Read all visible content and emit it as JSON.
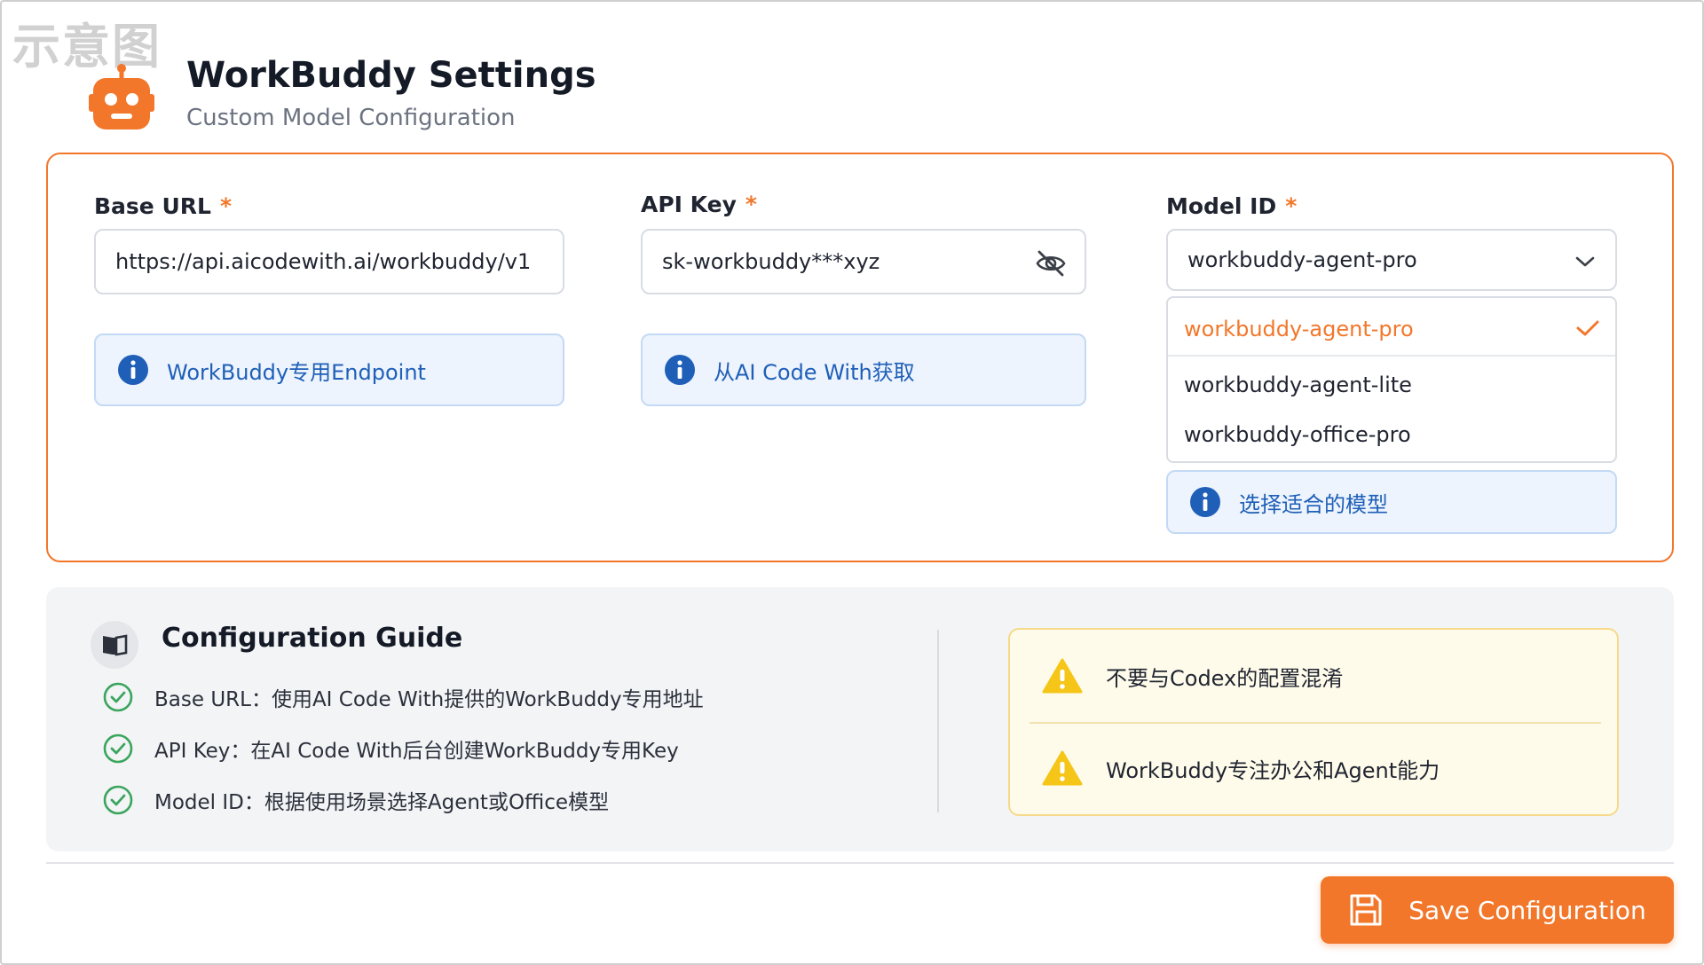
{
  "watermark": "示意图",
  "header": {
    "title": "WorkBuddy Settings",
    "subtitle": "Custom Model Configuration",
    "logo_icon": "robot-icon"
  },
  "colors": {
    "accent": "#f2772b",
    "info": "#1f5fb8",
    "success": "#3aa55d",
    "warning": "#f5c518"
  },
  "fields": {
    "base_url": {
      "label": "Base URL",
      "required_mark": "*",
      "value": "https://api.aicodewith.ai/workbuddy/v1",
      "hint": "WorkBuddy专用Endpoint"
    },
    "api_key": {
      "label": "API Key",
      "required_mark": "*",
      "value": "sk-workbuddy***xyz",
      "hint": "从AI Code With获取",
      "toggle_icon": "eye-off-icon"
    },
    "model_id": {
      "label": "Model ID",
      "required_mark": "*",
      "value": "workbuddy-agent-pro",
      "options": [
        "workbuddy-agent-pro",
        "workbuddy-agent-lite",
        "workbuddy-office-pro"
      ],
      "selected_index": 0,
      "hint": "选择适合的模型"
    }
  },
  "guide": {
    "title": "Configuration Guide",
    "icon": "book-icon",
    "items": [
      "Base URL：使用AI Code With提供的WorkBuddy专用地址",
      "API Key：在AI Code With后台创建WorkBuddy专用Key",
      "Model ID：根据使用场景选择Agent或Office模型"
    ],
    "warnings": [
      "不要与Codex的配置混淆",
      "WorkBuddy专注办公和Agent能力"
    ]
  },
  "actions": {
    "save_label": "Save Configuration",
    "save_icon": "save-icon"
  }
}
